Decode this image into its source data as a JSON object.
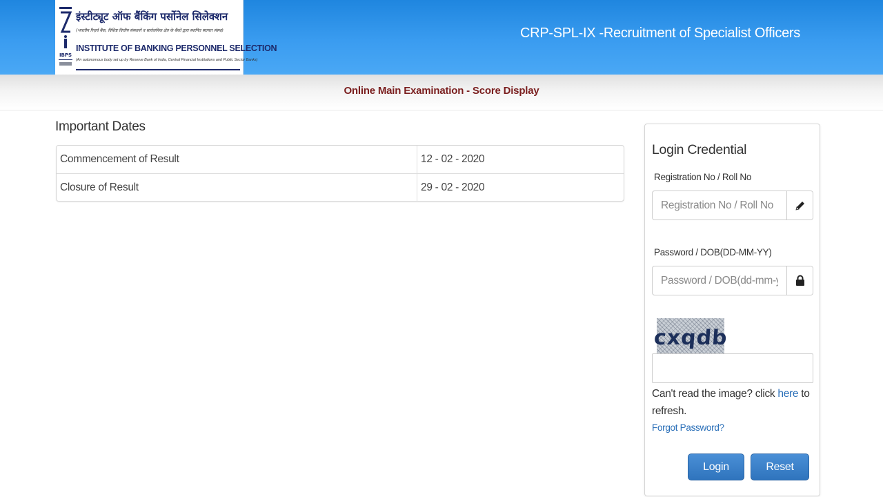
{
  "header": {
    "logo": {
      "hindi_name": "इंस्टीट्यूट ऑफ बैंकिंग पर्सोनेल सिलेक्शन",
      "hindi_subtitle": "(भारतीय रिज़र्व बैंक, विशिष्ट वित्तीय संस्थानों व सार्वजनिक क्षेत्र के बैंकों द्वारा स्थापित स्वायत्त संस्था)",
      "name": "INSTITUTE OF BANKING PERSONNEL SELECTION",
      "subtitle": "(An autonomous body set up by Reserve Bank of India, Central Financial Institutions and Public Sector Banks)",
      "mark_text": "IBPS"
    },
    "title": "CRP-SPL-IX -Recruitment of Specialist Officers"
  },
  "subheader": {
    "title": "Online Main Examination - Score Display"
  },
  "important_dates": {
    "heading": "Important Dates",
    "rows": [
      {
        "label": "Commencement of Result",
        "value": "12 - 02 - 2020"
      },
      {
        "label": "Closure of Result",
        "value": "29 - 02 - 2020"
      }
    ]
  },
  "login": {
    "heading": "Login Credential",
    "registration": {
      "label": "Registration No / Roll No",
      "placeholder": "Registration No / Roll No",
      "value": "",
      "icon": "pencil-icon"
    },
    "password": {
      "label": "Password / DOB(DD-MM-YY)",
      "placeholder": "Password / DOB(dd-mm-yy)",
      "value": "",
      "icon": "lock-icon"
    },
    "captcha": {
      "text": "cxqdb",
      "input_value": ""
    },
    "refresh": {
      "prefix": "Can't read the image? click ",
      "link": "here",
      "suffix": " to refresh."
    },
    "forgot_password": "Forgot Password?",
    "login_button": "Login",
    "reset_button": "Reset"
  },
  "colors": {
    "header_blue": "#2f92e8",
    "subheader_title": "#7a1e1e",
    "button_blue": "#3a80c8",
    "link_blue": "#2a6fb8"
  }
}
